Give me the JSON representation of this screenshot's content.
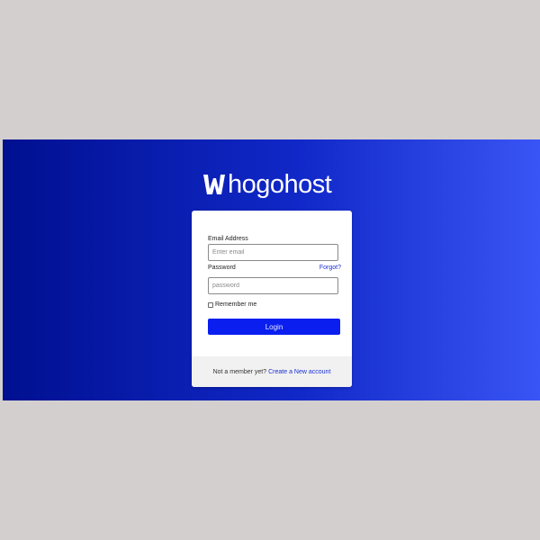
{
  "brand": {
    "name": "hogohost",
    "mark_letter": "W",
    "color": "#ffffff"
  },
  "colors": {
    "background": "#d3cfcf",
    "banner_left": "#001090",
    "banner_right": "#3a55f5",
    "accent": "#0a1ef0",
    "link": "#1a2fd0"
  },
  "login_form": {
    "email": {
      "label": "Email Address",
      "value": "",
      "placeholder": "Enter email"
    },
    "password": {
      "label": "Password",
      "value": "",
      "placeholder": "password",
      "forgot_link": "Forgot?"
    },
    "remember_me": {
      "label": "Remember me",
      "checked": false
    },
    "submit_label": "Login"
  },
  "footer": {
    "prompt": "Not a member yet?",
    "link_text": "Create a New account"
  }
}
